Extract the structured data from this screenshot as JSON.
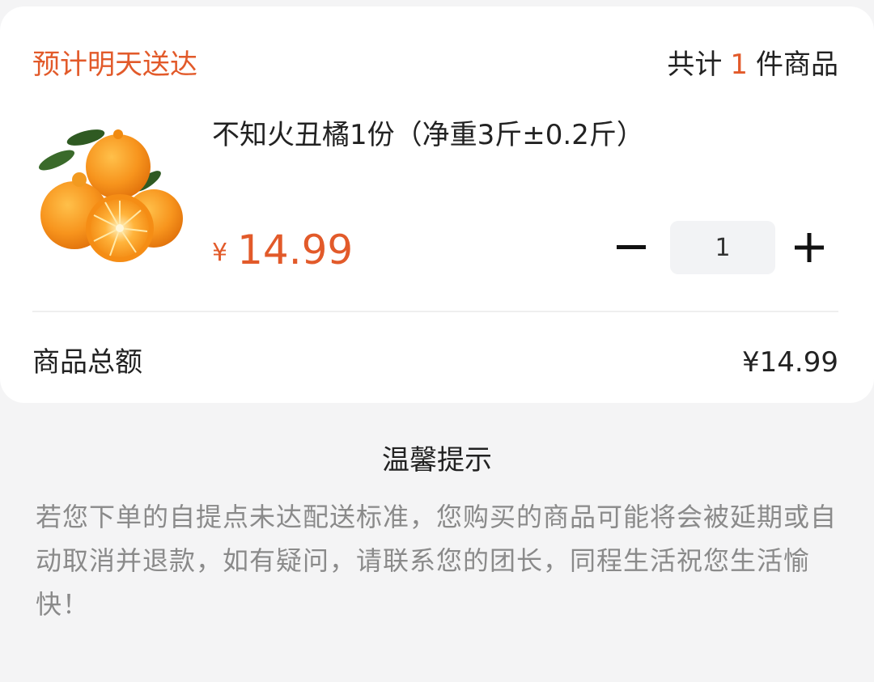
{
  "card": {
    "delivery": "预计明天送达",
    "count_prefix": "共计",
    "count": "1",
    "count_suffix": "件商品"
  },
  "product": {
    "name": "不知火丑橘1份（净重3斤±0.2斤）",
    "currency": "¥",
    "price": "14.99",
    "quantity": "1",
    "image_icon": "orange-fruit-image"
  },
  "summary": {
    "label": "商品总额",
    "value": "¥14.99"
  },
  "tip": {
    "title": "温馨提示",
    "body": "若您下单的自提点未达配送标准，您购买的商品可能将会被延期或自动取消并退款，如有疑问，请联系您的团长，同程生活祝您生活愉快！"
  },
  "colors": {
    "accent": "#e25a2a",
    "background": "#f4f4f5",
    "card": "#ffffff",
    "muted_text": "#8a8a8a"
  }
}
